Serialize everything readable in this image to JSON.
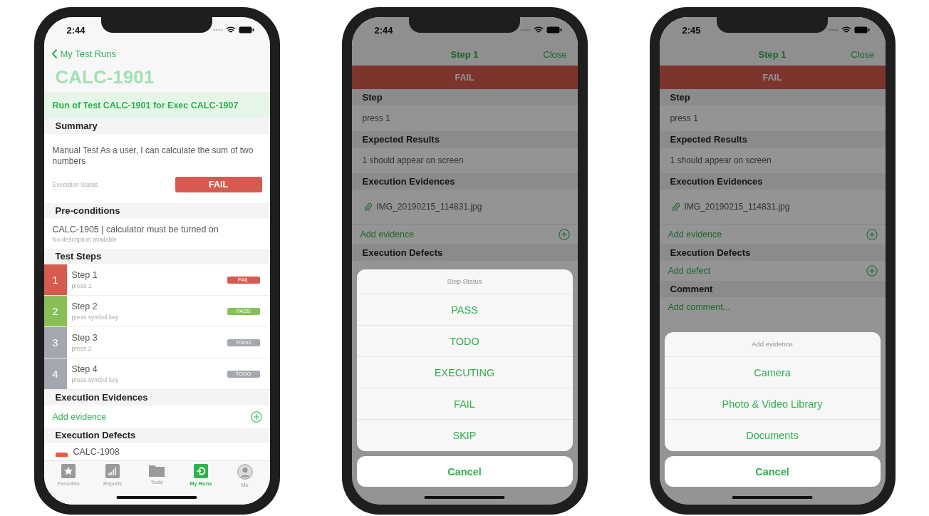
{
  "phones": [
    {
      "kind": "test_run",
      "dimmed": false,
      "time": "2:44",
      "back": "My Test Runs",
      "title": "CALC-1901",
      "banner": "Run of Test CALC-1901 for Exec CALC-1907",
      "summary": {
        "header": "Summary",
        "text": "Manual Test As a user, I can calculate the sum of two numbers",
        "status_label": "Execution Status",
        "status": {
          "kind": "fail",
          "label": "FAIL"
        }
      },
      "preconditions": {
        "header": "Pre-conditions",
        "title": "CALC-1905 | calculator must be turned on",
        "description": "No description available"
      },
      "steps_header": "Test Steps",
      "steps": [
        {
          "number": "1",
          "name": "Step 1",
          "action": "press 1",
          "status": "FAIL",
          "color": "#d65a4f"
        },
        {
          "number": "2",
          "name": "Step 2",
          "action": "press symbol key",
          "status": "PASS",
          "color": "#88c057"
        },
        {
          "number": "3",
          "name": "Step 3",
          "action": "press 2",
          "status": "TODO",
          "color": "#a3a7b0"
        },
        {
          "number": "4",
          "name": "Step 4",
          "action": "press symbol key",
          "status": "TODO",
          "color": "#a3a7b0"
        }
      ],
      "evidences_header": "Execution Evidences",
      "add_evidence": "Add evidence",
      "defects_header": "Execution Defects",
      "defects": [
        {
          "key": "CALC-1908",
          "color": "#f05a3c"
        }
      ],
      "tabs": [
        {
          "label": "Favorites",
          "selected": false
        },
        {
          "label": "Reports",
          "selected": false
        },
        {
          "label": "Tests",
          "selected": false
        },
        {
          "label": "My Runs",
          "selected": true
        },
        {
          "label": "Me",
          "selected": false
        }
      ]
    },
    {
      "kind": "step_detail",
      "dimmed": true,
      "time": "2:44",
      "title": "Step 1",
      "close": "Close",
      "status": {
        "kind": "fail",
        "label": "FAIL"
      },
      "rows": [
        {
          "kind": "header",
          "text": "Step"
        },
        {
          "kind": "text",
          "text": "press 1"
        },
        {
          "kind": "header",
          "text": "Expected Results"
        },
        {
          "kind": "text",
          "text": "1 should appear on screen"
        },
        {
          "kind": "header",
          "text": "Execution Evidences"
        },
        {
          "kind": "file",
          "text": "IMG_20190215_114831.jpg"
        },
        {
          "kind": "action",
          "text": "Add evidence",
          "add_icon": true
        },
        {
          "kind": "header",
          "text": "Execution Defects"
        }
      ],
      "sheet": {
        "title": "Step Status",
        "options": [
          "PASS",
          "TODO",
          "EXECUTING",
          "FAIL",
          "SKIP"
        ],
        "cancel": "Cancel"
      }
    },
    {
      "kind": "step_detail",
      "dimmed": true,
      "time": "2:45",
      "title": "Step 1",
      "close": "Close",
      "status": {
        "kind": "fail",
        "label": "FAIL"
      },
      "rows": [
        {
          "kind": "header",
          "text": "Step"
        },
        {
          "kind": "text",
          "text": "press 1"
        },
        {
          "kind": "header",
          "text": "Expected Results"
        },
        {
          "kind": "text",
          "text": "1 should appear on screen"
        },
        {
          "kind": "header",
          "text": "Execution Evidences"
        },
        {
          "kind": "file",
          "text": "IMG_20190215_114831.jpg"
        },
        {
          "kind": "action",
          "text": "Add evidence",
          "add_icon": true
        },
        {
          "kind": "header",
          "text": "Execution Defects"
        },
        {
          "kind": "action",
          "text": "Add defect",
          "add_icon": true
        },
        {
          "kind": "header",
          "text": "Comment"
        },
        {
          "kind": "action",
          "text": "Add comment...",
          "add_icon": false
        }
      ],
      "sheet": {
        "title": "Add evidence",
        "options": [
          "Camera",
          "Photo & Video Library",
          "Documents"
        ],
        "cancel": "Cancel"
      }
    }
  ]
}
